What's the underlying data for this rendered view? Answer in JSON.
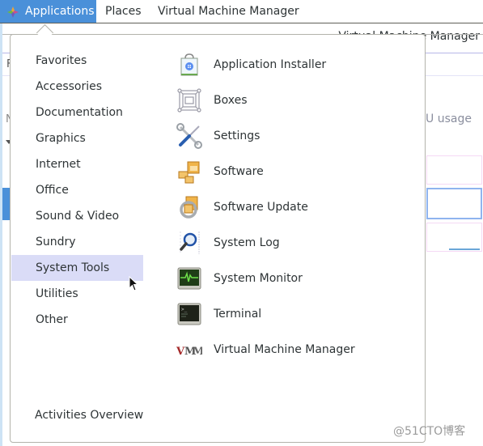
{
  "topbar": {
    "applications_label": "Applications",
    "places_label": "Places",
    "active_app_label": "Virtual Machine Manager",
    "applications_icon": "gnome-foot-icon"
  },
  "background_window": {
    "title": "Virtual Machine Manager",
    "file_menu_partial": "F",
    "name_column_partial": "N",
    "cpu_usage_partial": "U usage"
  },
  "menu": {
    "categories": [
      {
        "label": "Favorites"
      },
      {
        "label": "Accessories"
      },
      {
        "label": "Documentation"
      },
      {
        "label": "Graphics"
      },
      {
        "label": "Internet"
      },
      {
        "label": "Office"
      },
      {
        "label": "Sound & Video"
      },
      {
        "label": "Sundry"
      },
      {
        "label": "System Tools",
        "active": true
      },
      {
        "label": "Utilities"
      },
      {
        "label": "Other"
      }
    ],
    "apps": [
      {
        "label": "Application Installer",
        "icon": "application-installer-icon"
      },
      {
        "label": "Boxes",
        "icon": "boxes-icon"
      },
      {
        "label": "Settings",
        "icon": "settings-tools-icon"
      },
      {
        "label": "Software",
        "icon": "software-packages-icon"
      },
      {
        "label": "Software Update",
        "icon": "software-update-icon"
      },
      {
        "label": "System Log",
        "icon": "system-log-icon"
      },
      {
        "label": "System Monitor",
        "icon": "system-monitor-icon"
      },
      {
        "label": "Terminal",
        "icon": "terminal-icon"
      },
      {
        "label": "Virtual Machine Manager",
        "icon": "virt-manager-icon"
      }
    ],
    "activities_overview_label": "Activities Overview"
  },
  "watermark": "@51CTO博客",
  "colors": {
    "accent": "#4a90d9",
    "active_category": "#dadcf7"
  }
}
